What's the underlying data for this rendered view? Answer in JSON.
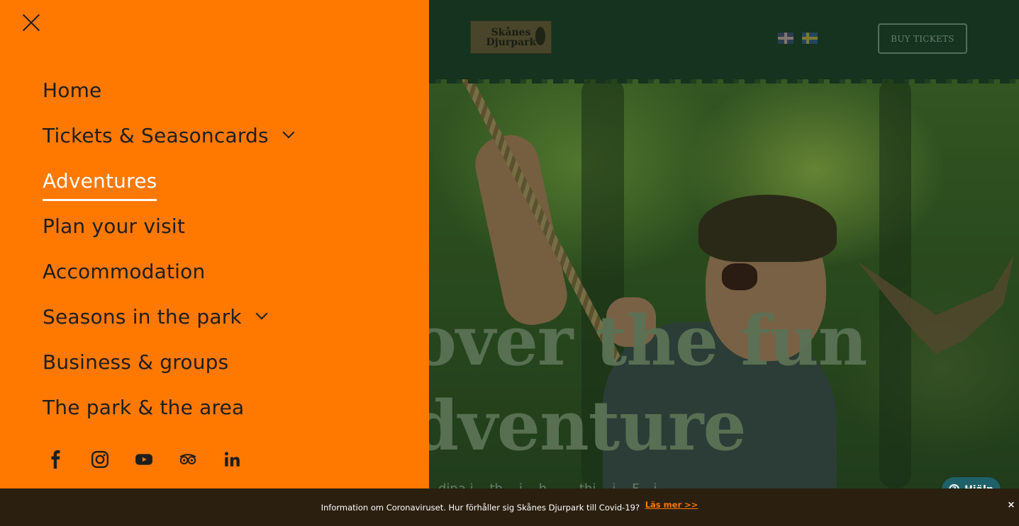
{
  "header": {
    "logo_text": "Skånes Djurpark",
    "buy_tickets_label": "BUY TICKETS",
    "languages": [
      "English",
      "Svenska"
    ]
  },
  "hero": {
    "line1": "over the fun",
    "line2": "dventure",
    "subtitle": "dina i... th... i... h... ... thi... i... F... i..."
  },
  "menu": {
    "items": [
      {
        "label": "Home",
        "has_submenu": false,
        "active": false
      },
      {
        "label": "Tickets & Seasoncards",
        "has_submenu": true,
        "active": false
      },
      {
        "label": "Adventures",
        "has_submenu": false,
        "active": true
      },
      {
        "label": "Plan your visit",
        "has_submenu": false,
        "active": false
      },
      {
        "label": "Accommodation",
        "has_submenu": false,
        "active": false
      },
      {
        "label": "Seasons in the park",
        "has_submenu": true,
        "active": false
      },
      {
        "label": "Business & groups",
        "has_submenu": false,
        "active": false
      },
      {
        "label": "The park & the area",
        "has_submenu": false,
        "active": false
      }
    ],
    "social": [
      "facebook-icon",
      "instagram-icon",
      "youtube-icon",
      "tripadvisor-icon",
      "linkedin-icon"
    ]
  },
  "covid_bar": {
    "text": "Information om Coronaviruset. Hur förhåller sig Skånes Djurpark till Covid-19?",
    "link_label": "Läs mer >>",
    "close_glyph": "×"
  },
  "help_widget": {
    "label": "Hjälp",
    "glyph": "?"
  },
  "colors": {
    "menu_bg": "#ff7800",
    "header_bg": "#1b3a22",
    "covid_bg": "#2b1f10",
    "help_bg": "#1f6168"
  }
}
